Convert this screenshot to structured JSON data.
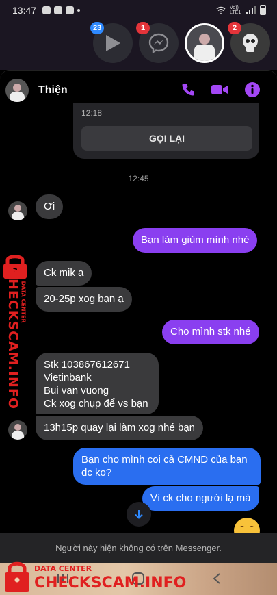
{
  "status_bar": {
    "time": "13:47",
    "carrier": "Vo)) LTE1"
  },
  "chat_heads": [
    {
      "id": "play",
      "badge": "23",
      "badge_color": "#2e89ff"
    },
    {
      "id": "messenger",
      "badge": "1",
      "badge_color": "#e4343a"
    },
    {
      "id": "user",
      "badge": "",
      "badge_color": ""
    },
    {
      "id": "skull",
      "badge": "2",
      "badge_color": "#e4343a"
    }
  ],
  "header": {
    "contact_name": "Thiện",
    "accent_color": "#a347f5",
    "icons": [
      "phone-icon",
      "video-camera-icon",
      "info-icon"
    ]
  },
  "call_card": {
    "time": "12:18",
    "button_label": "GỌI LẠI"
  },
  "timestamp": "12:45",
  "messages": [
    {
      "dir": "in",
      "text": "Ơi"
    },
    {
      "dir": "out",
      "text": "Bạn làm giùm mình nhé"
    },
    {
      "dir": "in",
      "text": "Ck mik ạ"
    },
    {
      "dir": "in",
      "text": "20-25p xog bạn ạ"
    },
    {
      "dir": "out",
      "text": "Cho mình stk nhé"
    },
    {
      "dir": "in",
      "lines": [
        "Stk 103867612671",
        "Vietinbank",
        "Bui van vuong",
        "Ck xog chụp để vs bạn"
      ]
    },
    {
      "dir": "in",
      "text": "13h15p quay lại làm xog nhé bạn"
    },
    {
      "dir": "out",
      "lines": [
        "Bạn cho mình coi cả CMND của bạn",
        "dc ko?"
      ]
    },
    {
      "dir": "out",
      "text": "Vì ck cho người lạ mà"
    }
  ],
  "notice": "Người này hiện không có trên Messenger.",
  "watermark": {
    "brand": "CHECKSCAM.INFO",
    "tagline": "DATA CENTER",
    "color": "#e02020"
  }
}
